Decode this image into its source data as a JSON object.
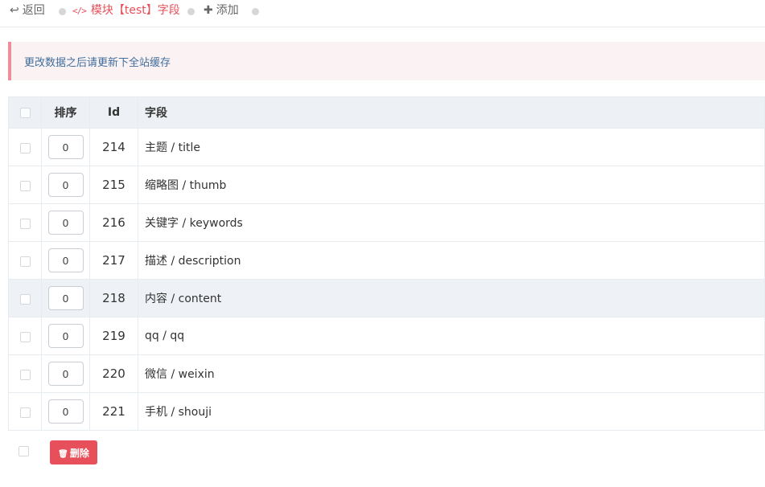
{
  "toolbar": {
    "back": {
      "icon": "reply-icon",
      "label": "返回"
    },
    "active": {
      "icon": "code-icon",
      "label": "模块【test】字段"
    },
    "add": {
      "icon": "plus-icon",
      "label": "添加"
    }
  },
  "alert": {
    "text": "更改数据之后请更新下全站缓存",
    "colors": {
      "border": "#ef8e9a",
      "background": "#fbf3f3",
      "text": "#3f6d9e"
    }
  },
  "table": {
    "headers": {
      "order": "排序",
      "id": "Id",
      "field": "字段"
    },
    "rows": [
      {
        "order": "0",
        "id": "214",
        "field": "主题 / title"
      },
      {
        "order": "0",
        "id": "215",
        "field": "缩略图 / thumb"
      },
      {
        "order": "0",
        "id": "216",
        "field": "关键字 / keywords"
      },
      {
        "order": "0",
        "id": "217",
        "field": "描述 / description"
      },
      {
        "order": "0",
        "id": "218",
        "field": "内容 / content",
        "highlighted": true
      },
      {
        "order": "0",
        "id": "219",
        "field": "qq / qq"
      },
      {
        "order": "0",
        "id": "220",
        "field": "微信 / weixin"
      },
      {
        "order": "0",
        "id": "221",
        "field": "手机 / shouji"
      }
    ]
  },
  "actions": {
    "delete": {
      "icon": "trash-icon",
      "label": "删除",
      "color": "#e7505a"
    }
  },
  "accent_color": "#e7505a"
}
